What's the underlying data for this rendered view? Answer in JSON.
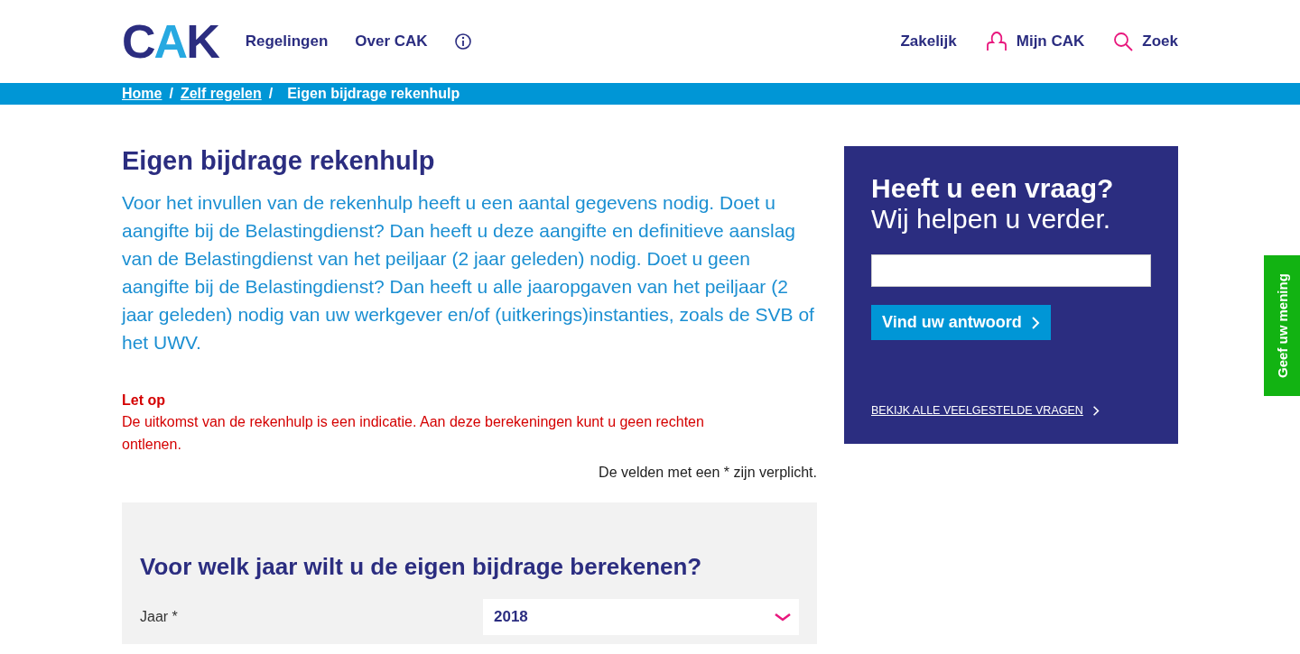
{
  "header": {
    "logo": "CAK",
    "nav": [
      {
        "label": "Regelingen"
      },
      {
        "label": "Over CAK"
      }
    ],
    "nav_right": [
      {
        "label": "Zakelijk",
        "kind": "plain"
      },
      {
        "label": "Mijn CAK",
        "kind": "account"
      },
      {
        "label": "Zoek",
        "kind": "search"
      }
    ]
  },
  "breadcrumb": [
    {
      "label": "Home",
      "link": true,
      "separator": "/"
    },
    {
      "label": "Zelf regelen",
      "link": true,
      "separator": "/"
    },
    {
      "label": "Eigen bijdrage rekenhulp",
      "link": false
    }
  ],
  "main": {
    "title": "Eigen bijdrage rekenhulp",
    "intro": "Voor het invullen van de rekenhulp heeft u een aantal gegevens nodig. Doet u aangifte bij de Belastingdienst? Dan heeft u deze aangifte en definitieve aanslag van de Belastingdienst van het peiljaar (2 jaar geleden) nodig. Doet u geen aangifte bij de Belastingdienst? Dan heeft u alle jaaropgaven van het peiljaar (2 jaar geleden) nodig van uw werkgever en/of (uitkerings)instanties, zoals de SVB of het UWV.",
    "notice_title": "Let op",
    "notice_text": "De uitkomst van de rekenhulp is een indicatie. Aan deze berekeningen kunt u geen rechten ontlenen.",
    "required_note": "De velden met een * zijn verplicht.",
    "form": {
      "heading": "Voor welk jaar wilt u de eigen bijdrage berekenen?",
      "field_label": "Jaar *",
      "field_value": "2018"
    }
  },
  "help_card": {
    "title": "Heeft u een vraag?",
    "subtitle": "Wij helpen u verder.",
    "button": "Vind uw antwoord",
    "link": "BEKIJK ALLE VEELGESTELDE VRAGEN"
  },
  "feedback_tab": "Geef uw mening"
}
